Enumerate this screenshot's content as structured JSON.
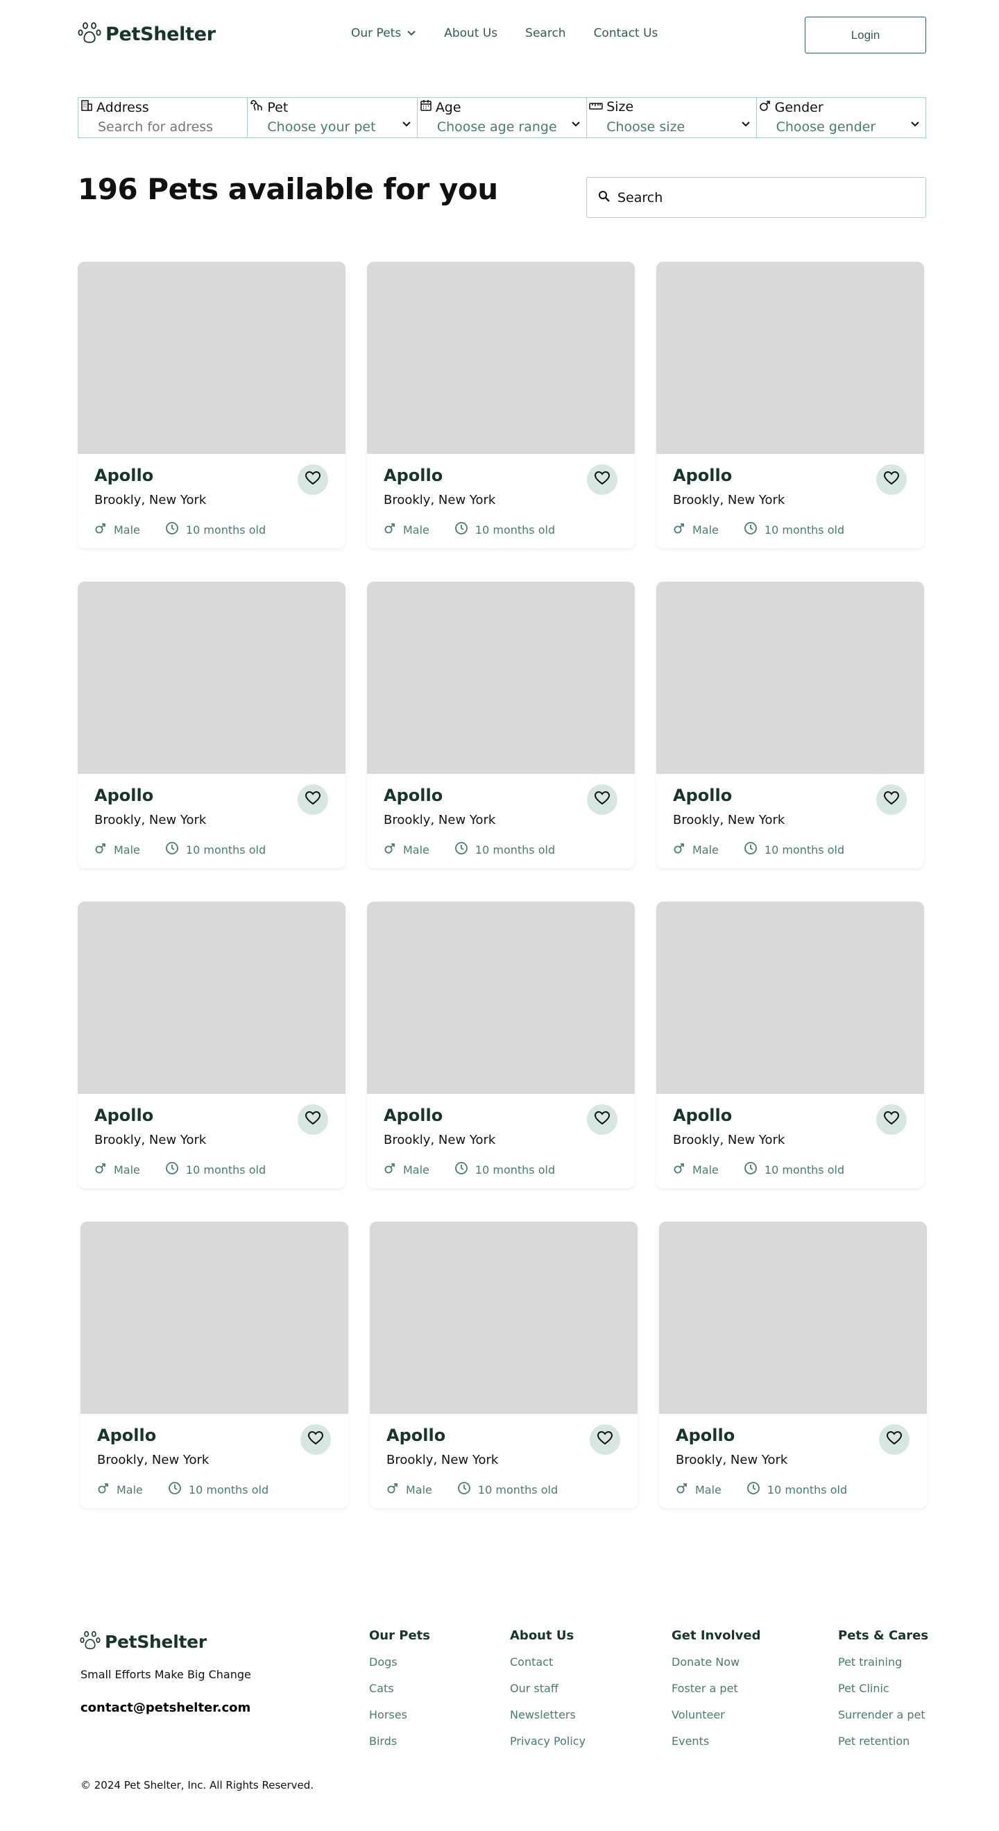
{
  "brand": {
    "name": "PetShelter"
  },
  "nav": {
    "items": [
      {
        "label": "Our Pets",
        "dropdown": true
      },
      {
        "label": "About Us",
        "dropdown": false
      },
      {
        "label": "Search",
        "dropdown": false
      },
      {
        "label": "Contact Us",
        "dropdown": false
      }
    ],
    "login_label": "Login"
  },
  "filters": [
    {
      "label": "Address",
      "value": "Search for adress",
      "icon": "building-icon",
      "dropdown": false
    },
    {
      "label": "Pet",
      "value": "Choose your pet",
      "icon": "dog-icon",
      "dropdown": true
    },
    {
      "label": "Age",
      "value": "Choose age range",
      "icon": "calendar-icon",
      "dropdown": true
    },
    {
      "label": "Size",
      "value": "Choose size",
      "icon": "ruler-icon",
      "dropdown": true
    },
    {
      "label": "Gender",
      "value": "Choose gender",
      "icon": "male-icon",
      "dropdown": true
    }
  ],
  "main": {
    "title": "196 Pets available for you",
    "search_placeholder": "Search"
  },
  "pets": [
    {
      "name": "Apollo",
      "location": "Brookly, New York",
      "gender": "Male",
      "age": "10 months old"
    },
    {
      "name": "Apollo",
      "location": "Brookly, New York",
      "gender": "Male",
      "age": "10 months old"
    },
    {
      "name": "Apollo",
      "location": "Brookly, New York",
      "gender": "Male",
      "age": "10 months old"
    },
    {
      "name": "Apollo",
      "location": "Brookly, New York",
      "gender": "Male",
      "age": "10 months old"
    },
    {
      "name": "Apollo",
      "location": "Brookly, New York",
      "gender": "Male",
      "age": "10 months old"
    },
    {
      "name": "Apollo",
      "location": "Brookly, New York",
      "gender": "Male",
      "age": "10 months old"
    },
    {
      "name": "Apollo",
      "location": "Brookly, New York",
      "gender": "Male",
      "age": "10 months old"
    },
    {
      "name": "Apollo",
      "location": "Brookly, New York",
      "gender": "Male",
      "age": "10 months old"
    },
    {
      "name": "Apollo",
      "location": "Brookly, New York",
      "gender": "Male",
      "age": "10 months old"
    },
    {
      "name": "Apollo",
      "location": "Brookly, New York",
      "gender": "Male",
      "age": "10 months old"
    },
    {
      "name": "Apollo",
      "location": "Brookly, New York",
      "gender": "Male",
      "age": "10 months old"
    },
    {
      "name": "Apollo",
      "location": "Brookly, New York",
      "gender": "Male",
      "age": "10 months old"
    }
  ],
  "footer": {
    "tagline": "Small Efforts Make Big Change",
    "email": "contact@petshelter.com",
    "columns": [
      {
        "title": "Our Pets",
        "links": [
          "Dogs",
          "Cats",
          "Horses",
          "Birds"
        ]
      },
      {
        "title": "About Us",
        "links": [
          "Contact",
          "Our staff",
          "Newsletters",
          "Privacy Policy"
        ]
      },
      {
        "title": "Get Involved",
        "links": [
          "Donate Now",
          "Foster a pet",
          "Volunteer",
          "Events"
        ]
      },
      {
        "title": "Pets & Cares",
        "links": [
          "Pet training",
          "Pet Clinic",
          "Surrender a pet",
          "Pet retention"
        ]
      }
    ],
    "copyright": "© 2024 Pet Shelter, Inc. All Rights Reserved."
  },
  "colors": {
    "brand_dark": "#16352b",
    "accent_green": "#467e6e",
    "border_mint": "#a4d2c1",
    "fav_bg": "#d6e7e1",
    "image_placeholder": "#d9d9d9"
  }
}
